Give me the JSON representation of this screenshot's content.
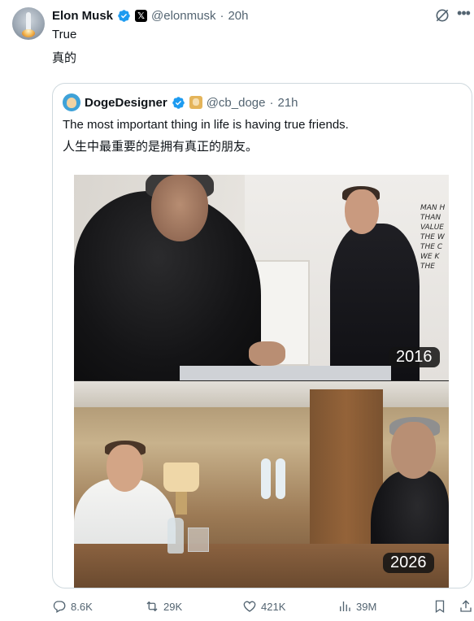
{
  "post": {
    "author_name": "Elon Musk",
    "author_handle": "@elonmusk",
    "timestamp": "20h",
    "text_line1": "True",
    "text_line2": "真的"
  },
  "quote": {
    "author_name": "DogeDesigner",
    "author_handle": "@cb_doge",
    "timestamp": "21h",
    "text_line1": "The most important thing in life is having true friends.",
    "text_line2": "人生中最重要的是拥有真正的朋友。",
    "image_top_label": "2016",
    "image_bottom_label": "2026",
    "wall_text": "MAN H\nTHAN\nVALUE\nTHE W\nTHE C\nWE K\nTHE"
  },
  "metrics": {
    "replies": "8.6K",
    "reposts": "29K",
    "likes": "421K",
    "views": "39M"
  },
  "colors": {
    "verified": "#1d9bf0",
    "muted": "#536471",
    "border": "#cfd9de"
  },
  "icons": [
    "grok-icon",
    "more-icon",
    "verified-icon",
    "x-badge-icon",
    "reply-icon",
    "repost-icon",
    "like-icon",
    "views-icon",
    "bookmark-icon",
    "share-icon"
  ]
}
